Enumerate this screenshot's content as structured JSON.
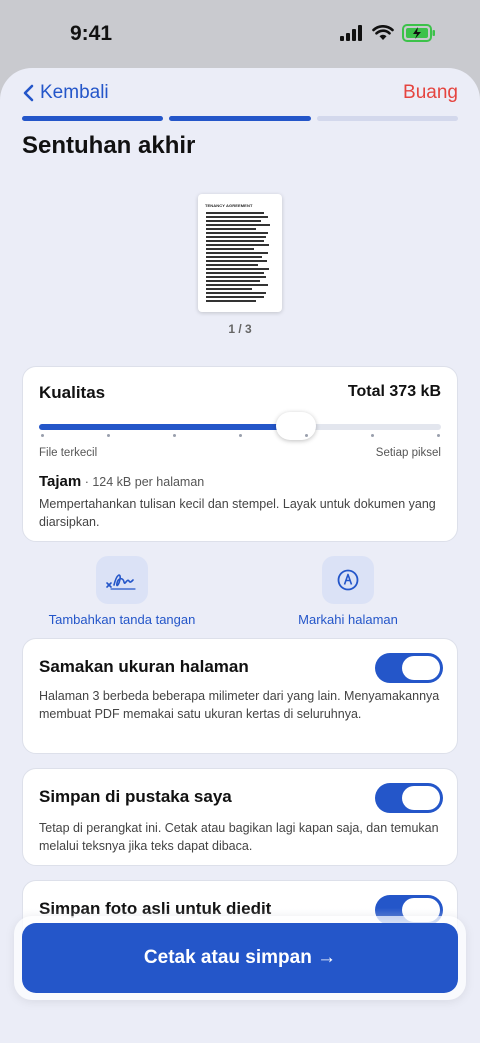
{
  "status": {
    "time": "9:41",
    "signal_icon": "cellular-signal-icon",
    "wifi_icon": "wifi-icon",
    "battery_icon": "battery-charging-icon"
  },
  "nav": {
    "back_label": "Kembali",
    "discard_label": "Buang",
    "steps_total": 3,
    "steps_done": 2
  },
  "page": {
    "title": "Sentuhan akhir"
  },
  "preview": {
    "doc_title": "TENANCY AGREEMENT",
    "pager": "1 / 3"
  },
  "quality": {
    "heading": "Kualitas",
    "total": "Total 373 kB",
    "slider_fraction": 0.64,
    "stops": 7,
    "min_label": "File terkecil",
    "max_label": "Setiap piksel",
    "level_name": "Tajam",
    "level_detail": " · 124 kB per halaman",
    "description": "Mempertahankan tulisan kecil dan stempel. Layak untuk dokumen yang diarsipkan."
  },
  "actions": [
    {
      "label": "Tambahkan tanda tangan",
      "icon": "signature-icon"
    },
    {
      "label": "Markahi halaman",
      "icon": "markup-pen-icon"
    }
  ],
  "settings": [
    {
      "title": "Samakan ukuran halaman",
      "description": "Halaman 3 berbeda beberapa milimeter dari yang lain. Menyamakannya membuat PDF memakai satu ukuran kertas di seluruhnya.",
      "on": true
    },
    {
      "title": "Simpan di pustaka saya",
      "description": "Tetap di perangkat ini. Cetak atau bagikan lagi kapan saja, dan temukan melalui teksnya jika teks dapat dibaca.",
      "on": true
    },
    {
      "title": "Simpan foto asli untuk diedit",
      "description": "",
      "on": true
    }
  ],
  "cta": {
    "label": "Cetak atau simpan →"
  },
  "colors": {
    "accent": "#2456c9",
    "danger": "#e5443f",
    "background": "#ebedf7"
  }
}
